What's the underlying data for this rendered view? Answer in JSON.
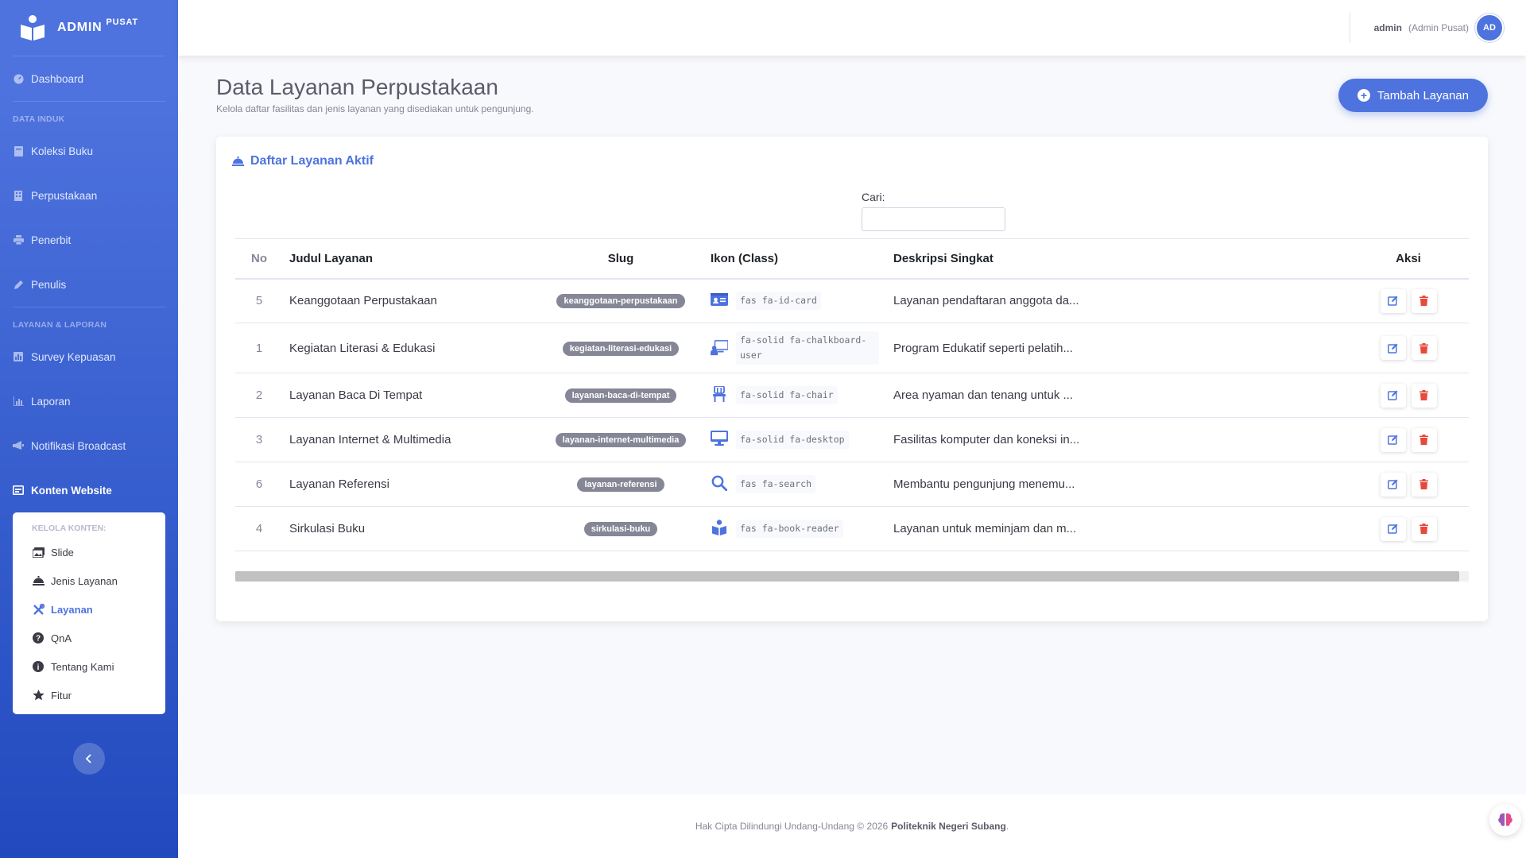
{
  "brand": {
    "name": "ADMIN",
    "suffix": "PUSAT"
  },
  "sidebar": {
    "dashboard": "Dashboard",
    "heading_data": "DATA INDUK",
    "koleksi": "Koleksi Buku",
    "perpustakaan": "Perpustakaan",
    "penerbit": "Penerbit",
    "penulis": "Penulis",
    "heading_layanan": "LAYANAN & LAPORAN",
    "survey": "Survey Kepuasan",
    "laporan": "Laporan",
    "notifikasi": "Notifikasi Broadcast",
    "konten": "Konten Website",
    "submenu": {
      "heading": "KELOLA KONTEN:",
      "items": [
        "Slide",
        "Jenis Layanan",
        "Layanan",
        "QnA",
        "Tentang Kami",
        "Fitur"
      ],
      "active_index": 2
    }
  },
  "topbar": {
    "user_name": "admin",
    "user_role": "(Admin Pusat)",
    "avatar_text": "AD"
  },
  "page": {
    "title": "Data Layanan Perpustakaan",
    "subtitle": "Kelola daftar fasilitas dan jenis layanan yang disediakan untuk pengunjung.",
    "add_button": "Tambah Layanan"
  },
  "card": {
    "title": "Daftar Layanan Aktif",
    "search_label": "Cari:",
    "columns": [
      "No",
      "Judul Layanan",
      "Slug",
      "Ikon (Class)",
      "Deskripsi Singkat",
      "Aksi"
    ],
    "rows": [
      {
        "no": "5",
        "judul": "Keanggotaan Perpustakaan",
        "slug": "keanggotaan-perpustakaan",
        "ikon": "fas fa-id-card",
        "icon_name": "id-card-icon",
        "desk": "Layanan pendaftaran anggota da..."
      },
      {
        "no": "1",
        "judul": "Kegiatan Literasi & Edukasi",
        "slug": "kegiatan-literasi-edukasi",
        "ikon": "fa-solid fa-chalkboard-user",
        "icon_name": "chalkboard-user-icon",
        "desk": "Program Edukatif seperti pelatih..."
      },
      {
        "no": "2",
        "judul": "Layanan Baca Di Tempat",
        "slug": "layanan-baca-di-tempat",
        "ikon": "fa-solid fa-chair",
        "icon_name": "chair-icon",
        "desk": "Area nyaman dan tenang untuk ..."
      },
      {
        "no": "3",
        "judul": "Layanan Internet & Multimedia",
        "slug": "layanan-internet-multimedia",
        "ikon": "fa-solid fa-desktop",
        "icon_name": "desktop-icon",
        "desk": "Fasilitas komputer dan koneksi in..."
      },
      {
        "no": "6",
        "judul": "Layanan Referensi",
        "slug": "layanan-referensi",
        "ikon": "fas fa-search",
        "icon_name": "search-icon",
        "desk": "Membantu pengunjung menemu..."
      },
      {
        "no": "4",
        "judul": "Sirkulasi Buku",
        "slug": "sirkulasi-buku",
        "ikon": "fas fa-book-reader",
        "icon_name": "book-reader-icon",
        "desk": "Layanan untuk meminjam dan m..."
      }
    ]
  },
  "footer": {
    "text": "Hak Cipta Dilindungi Undang-Undang © 2026",
    "org": "Politeknik Negeri Subang",
    "dot": "."
  },
  "colors": {
    "primary": "#4e73df",
    "danger": "#e74a3b",
    "badge": "#858796"
  }
}
